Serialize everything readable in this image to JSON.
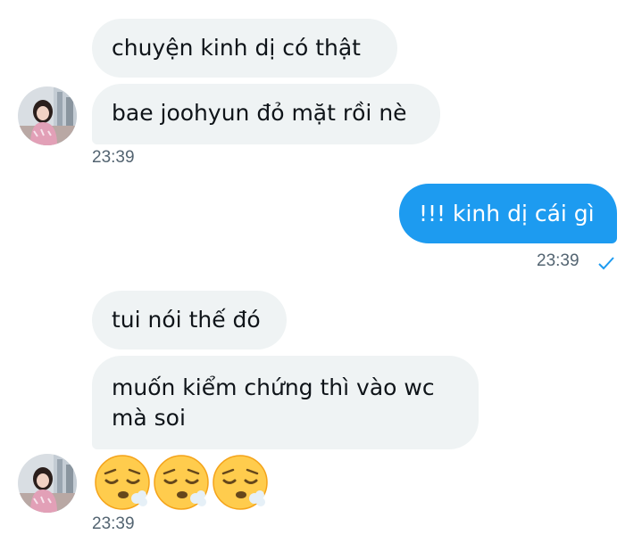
{
  "messages": {
    "incoming1": {
      "line1": "chuyện kinh dị có thật",
      "line2": "bae joohyun đỏ mặt rồi nè",
      "time": "23:39"
    },
    "outgoing": {
      "text": "!!! kinh dị cái gì",
      "time": "23:39",
      "status_icon": "sent-check-icon"
    },
    "incoming2": {
      "line1": "tui nói thế đó",
      "line2a": "muốn kiểm chứng thì vào wc",
      "line2b": "mà soi",
      "emojis": [
        "tired-face-emoji",
        "tired-face-emoji",
        "tired-face-emoji"
      ],
      "time": "23:39"
    }
  },
  "colors": {
    "incoming_bubble": "#eff3f4",
    "outgoing_bubble": "#1d9bf0",
    "timestamp": "#536471",
    "check": "#1d9bf0"
  }
}
